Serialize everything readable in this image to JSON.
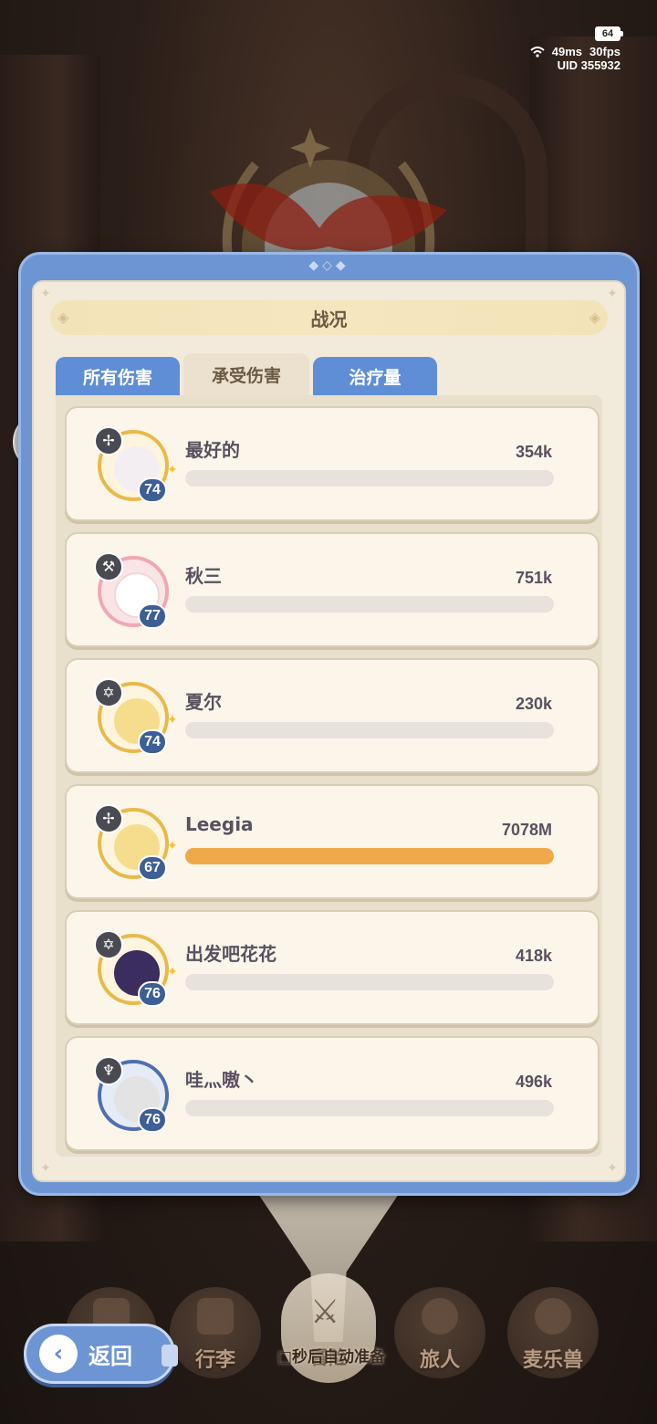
{
  "hud": {
    "battery": "64",
    "ping": "49ms",
    "fps": "30fps",
    "uid": "UID 355932"
  },
  "panel": {
    "title": "战况",
    "tabs": [
      {
        "label": "所有伤害",
        "active": false
      },
      {
        "label": "承受伤害",
        "active": true
      },
      {
        "label": "治疗量",
        "active": false
      }
    ]
  },
  "players": [
    {
      "name": "最好的",
      "value": "354k",
      "level": "74",
      "class_icon": "sword-cross-icon",
      "bar_fraction": 0.0
    },
    {
      "name": "秋三",
      "value": "751k",
      "level": "77",
      "class_icon": "pickaxe-icon",
      "bar_fraction": 0.0
    },
    {
      "name": "夏尔",
      "value": "230k",
      "level": "74",
      "class_icon": "hexagram-icon",
      "bar_fraction": 0.0
    },
    {
      "name": "Leegia",
      "value": "7078M",
      "level": "67",
      "class_icon": "sword-cross-icon",
      "bar_fraction": 1.0
    },
    {
      "name": "出发吧花花",
      "value": "418k",
      "level": "76",
      "class_icon": "hexagram-icon",
      "bar_fraction": 0.0
    },
    {
      "name": "哇灬嗷丶",
      "value": "496k",
      "level": "76",
      "class_icon": "trident-icon",
      "bar_fraction": 0.0
    }
  ],
  "nav": {
    "back_label": "返回",
    "items": [
      "行李",
      "冒险",
      "旅人",
      "麦乐兽"
    ],
    "countdown": "□秒后自动准备"
  },
  "colors": {
    "frame_blue": "#6e95d3",
    "bar_fill": "#f0a94a",
    "level_badge": "#3d5f96"
  }
}
